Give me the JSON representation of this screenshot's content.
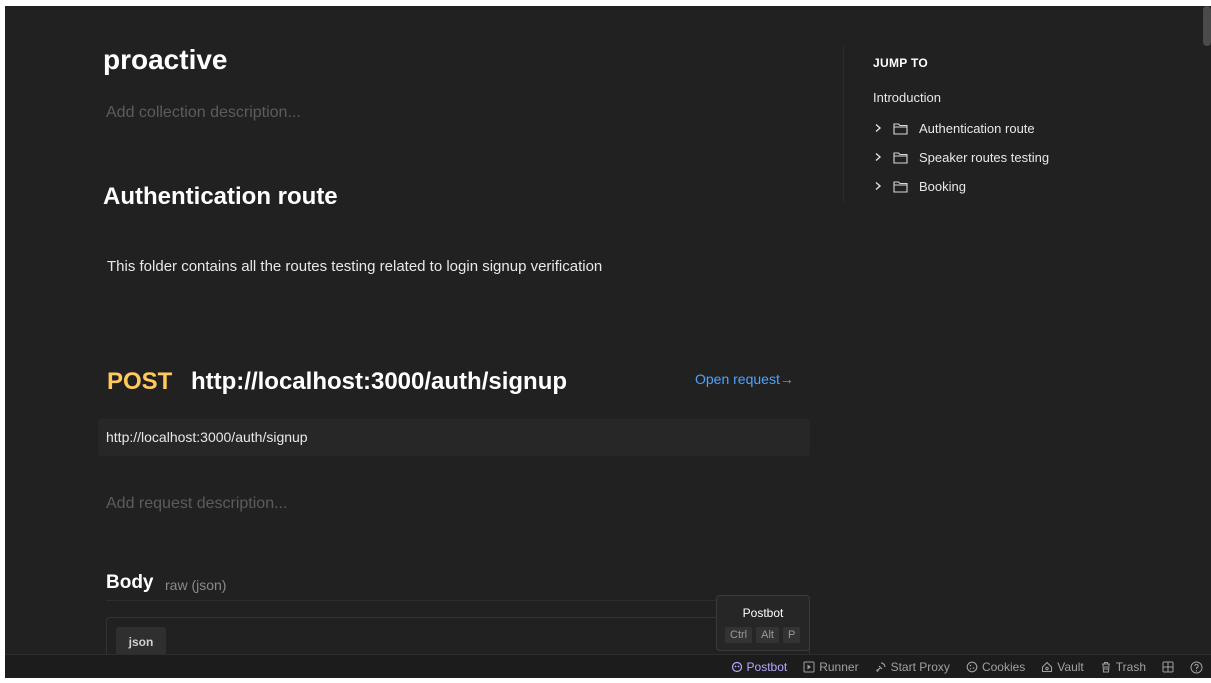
{
  "collection": {
    "title": "proactive",
    "description_placeholder": "Add collection description..."
  },
  "folder": {
    "title": "Authentication route",
    "description": "This folder contains all the routes testing related to login signup verification"
  },
  "request": {
    "method": "POST",
    "name": "http://localhost:3000/auth/signup",
    "open_label": "Open request→",
    "url": "http://localhost:3000/auth/signup",
    "description_placeholder": "Add request description..."
  },
  "body": {
    "label": "Body",
    "type": "raw (json)",
    "tab": "json"
  },
  "jump_to": {
    "title": "JUMP TO",
    "intro": "Introduction",
    "items": [
      {
        "label": "Authentication route",
        "icon": "folder-icon"
      },
      {
        "label": "Speaker routes testing",
        "icon": "folder-icon"
      },
      {
        "label": "Booking",
        "icon": "folder-icon"
      }
    ]
  },
  "tooltip": {
    "title": "Postbot",
    "keys": [
      "Ctrl",
      "Alt",
      "P"
    ]
  },
  "statusbar": {
    "postbot": "Postbot",
    "runner": "Runner",
    "start_proxy": "Start Proxy",
    "cookies": "Cookies",
    "vault": "Vault",
    "trash": "Trash"
  },
  "colors": {
    "background": "#212121",
    "method_post": "#ffc95c",
    "link": "#4ea3ff",
    "postbot_accent": "#b9a8ff"
  }
}
